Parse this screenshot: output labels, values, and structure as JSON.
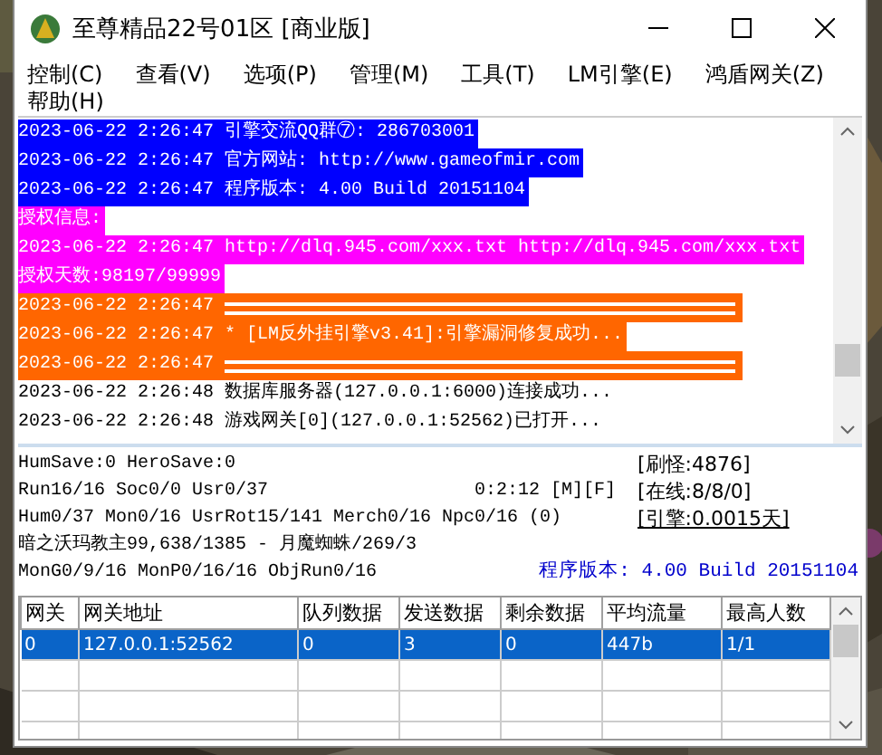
{
  "window": {
    "title": "至尊精品22号01区 [商业版]"
  },
  "menu": [
    "控制(C)",
    "查看(V)",
    "选项(P)",
    "管理(M)",
    "工具(T)",
    "LM引擎(E)",
    "鸿盾网关(Z)",
    "帮助(H)"
  ],
  "log": [
    {
      "kind": "highlight",
      "color": "#0000ff",
      "text": "2023-06-22 2:26:47 引擎交流QQ群⑦: 286703001"
    },
    {
      "kind": "highlight",
      "color": "#0000ff",
      "text": "2023-06-22 2:26:47 官方网站: http://www.gameofmir.com"
    },
    {
      "kind": "highlight",
      "color": "#0000ff",
      "text": "2023-06-22 2:26:47 程序版本: 4.00 Build 20151104"
    },
    {
      "kind": "highlight",
      "color": "#ff00ff",
      "text": "授权信息:"
    },
    {
      "kind": "highlight",
      "color": "#ff00ff",
      "text": "2023-06-22 2:26:47 http://dlq.945.com/xxx.txt http://dlq.945.com/xxx.txt"
    },
    {
      "kind": "highlight",
      "color": "#ff00ff",
      "text": "授权天数:98197/99999"
    },
    {
      "kind": "rule",
      "color": "#ff6600",
      "text": "2023-06-22 2:26:47"
    },
    {
      "kind": "highlight",
      "color": "#ff6600",
      "text": "2023-06-22 2:26:47 * [LM反外挂引擎v3.41]:引擎漏洞修复成功..."
    },
    {
      "kind": "rule",
      "color": "#ff6600",
      "text": "2023-06-22 2:26:47"
    },
    {
      "kind": "plain",
      "text": "2023-06-22 2:26:48 数据库服务器(127.0.0.1:6000)连接成功..."
    },
    {
      "kind": "plain",
      "text": "2023-06-22 2:26:48 游戏网关[0](127.0.0.1:52562)已打开..."
    }
  ],
  "status": {
    "lines": [
      "HumSave:0 HeroSave:0",
      "Run16/16 Soc0/0 Usr0/37",
      "Hum0/37 Mon0/16 UsrRot15/141 Merch0/16 Npc0/16 (0)",
      "暗之沃玛教主99,638/1385 - 月魔蜘蛛/269/3",
      "MonG0/9/16 MonP0/16/16 ObjRun0/16"
    ],
    "timer": "0:2:12 [M][F]",
    "monsters": "[刷怪:4876]",
    "online": "[在线:8/8/0]",
    "engine": "[引擎:0.0015天]",
    "version": "程序版本: 4.00 Build 20151104"
  },
  "table": {
    "columns": [
      "网关",
      "网关地址",
      "队列数据",
      "发送数据",
      "剩余数据",
      "平均流量",
      "最高人数"
    ],
    "rows": [
      {
        "selected": true,
        "cells": [
          "0",
          "127.0.0.1:52562",
          "0",
          "3",
          "0",
          "447b",
          "1/1"
        ]
      }
    ]
  }
}
